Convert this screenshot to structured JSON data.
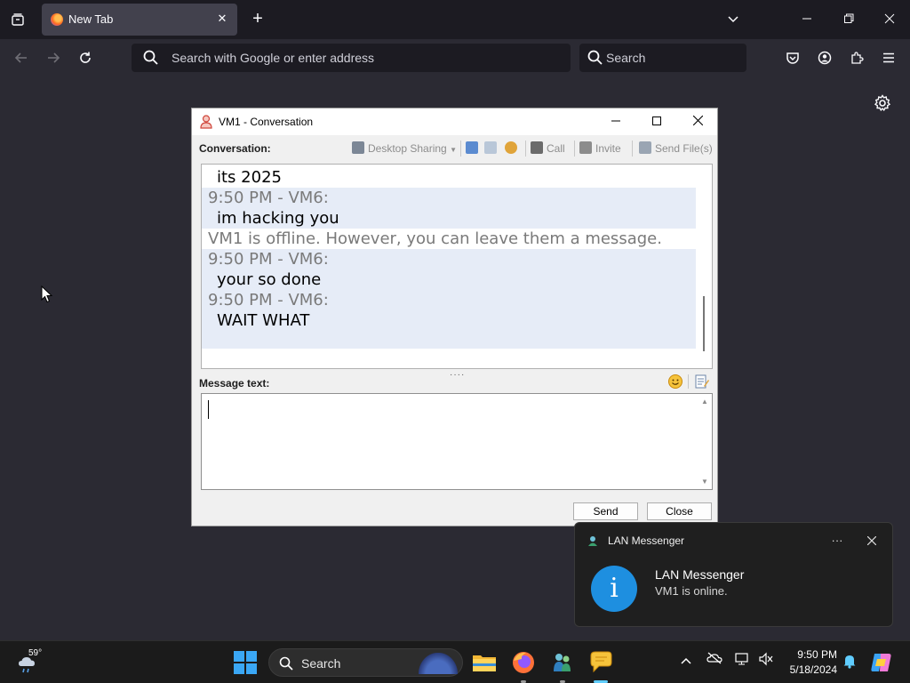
{
  "browser": {
    "tab_title": "New Tab",
    "url_placeholder": "Search with Google or enter address",
    "search_placeholder": "Search"
  },
  "conversation_window": {
    "title": "VM1 - Conversation",
    "conversation_label": "Conversation:",
    "toolbar": {
      "desktop_sharing": "Desktop Sharing",
      "call": "Call",
      "invite": "Invite",
      "send_files": "Send File(s)"
    },
    "lines": [
      {
        "kind": "body",
        "text": "its 2025",
        "highlight": false
      },
      {
        "kind": "head",
        "text": "9:50 PM - VM6:",
        "highlight": true
      },
      {
        "kind": "body",
        "text": "im hacking you",
        "highlight": true
      },
      {
        "kind": "sys",
        "text": "VM1 is offline. However, you can leave them a message.",
        "highlight": false
      },
      {
        "kind": "head",
        "text": "9:50 PM - VM6:",
        "highlight": true
      },
      {
        "kind": "body",
        "text": "your so done",
        "highlight": true
      },
      {
        "kind": "head",
        "text": "9:50 PM - VM6:",
        "highlight": true
      },
      {
        "kind": "body",
        "text": "WAIT WHAT",
        "highlight": true
      }
    ],
    "message_label": "Message text:",
    "message_value": "",
    "send_label": "Send",
    "close_label": "Close"
  },
  "notification": {
    "app_name": "LAN Messenger",
    "title": "LAN Messenger",
    "message": "VM1 is online."
  },
  "taskbar": {
    "weather_temp": "59°",
    "search_label": "Search",
    "time": "9:50 PM",
    "date": "5/18/2024"
  },
  "colors": {
    "accent": "#60cdff",
    "highlight_row": "#e6ecf7",
    "info_blue": "#1e8fe0"
  }
}
